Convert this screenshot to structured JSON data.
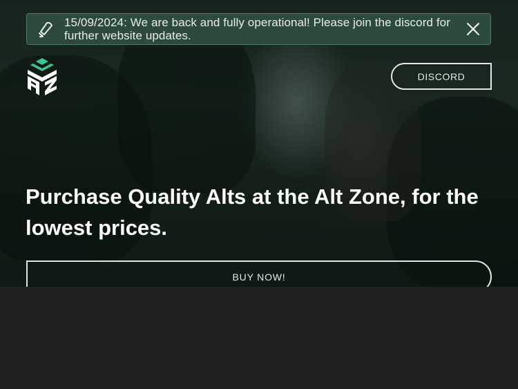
{
  "notice": {
    "text": "15/09/2024: We are back and fully operational! Please join the discord for further website updates.",
    "icon": "bell-icon",
    "close_icon": "close-icon"
  },
  "header": {
    "logo": "AZ",
    "discord_label": "DISCORD"
  },
  "hero": {
    "headline": "Purchase Quality Alts at the Alt Zone, for the lowest prices.",
    "buy_label": "BUY NOW!"
  },
  "colors": {
    "notice_bg": "#2d4a3b",
    "notice_border": "#4f7a65",
    "logo_accent": "#3fc48d",
    "page_bg": "#212121",
    "button_border": "#e6e6e6"
  }
}
